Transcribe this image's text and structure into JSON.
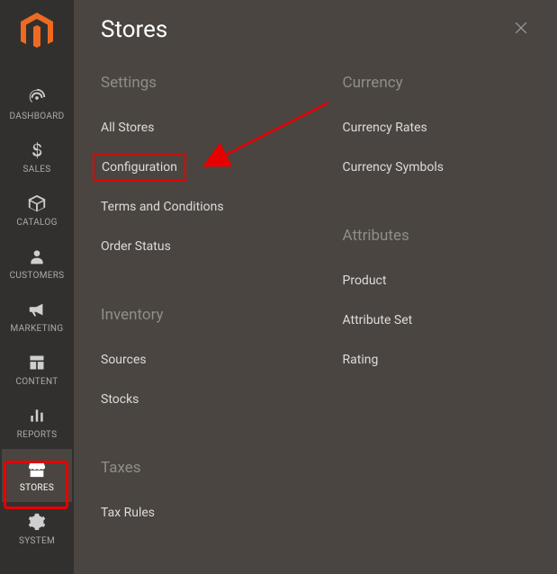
{
  "panel_title": "Stores",
  "sidebar": {
    "items": [
      {
        "label": "Dashboard"
      },
      {
        "label": "Sales"
      },
      {
        "label": "Catalog"
      },
      {
        "label": "Customers"
      },
      {
        "label": "Marketing"
      },
      {
        "label": "Content"
      },
      {
        "label": "Reports"
      },
      {
        "label": "Stores"
      },
      {
        "label": "System"
      }
    ]
  },
  "left_column": {
    "sections": [
      {
        "title": "Settings",
        "links": [
          {
            "label": "All Stores"
          },
          {
            "label": "Configuration",
            "highlighted": true
          },
          {
            "label": "Terms and Conditions"
          },
          {
            "label": "Order Status"
          }
        ]
      },
      {
        "title": "Inventory",
        "links": [
          {
            "label": "Sources"
          },
          {
            "label": "Stocks"
          }
        ]
      },
      {
        "title": "Taxes",
        "links": [
          {
            "label": "Tax Rules"
          }
        ]
      }
    ]
  },
  "right_column": {
    "sections": [
      {
        "title": "Currency",
        "links": [
          {
            "label": "Currency Rates"
          },
          {
            "label": "Currency Symbols"
          }
        ]
      },
      {
        "title": "Attributes",
        "links": [
          {
            "label": "Product"
          },
          {
            "label": "Attribute Set"
          },
          {
            "label": "Rating"
          }
        ]
      }
    ]
  }
}
